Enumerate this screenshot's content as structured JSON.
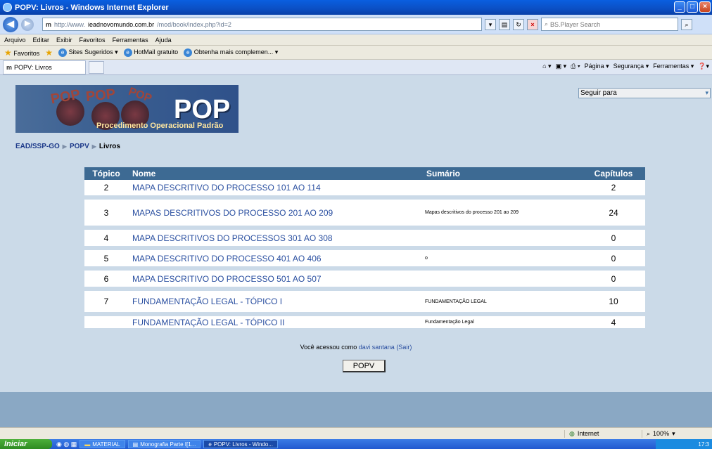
{
  "window": {
    "title": "POPV: Livros - Windows Internet Explorer"
  },
  "address": {
    "prefix": "http://www.",
    "domain": "ieadnovomundo.com.br",
    "path": "/mod/book/index.php?id=2"
  },
  "search": {
    "placeholder": "BS.Player Search"
  },
  "menu": [
    "Arquivo",
    "Editar",
    "Exibir",
    "Favoritos",
    "Ferramentas",
    "Ajuda"
  ],
  "favorites": {
    "label": "Favoritos",
    "items": [
      "Sites Sugeridos ▾",
      "HotMail gratuito",
      "Obtenha mais complemen... ▾"
    ]
  },
  "tab": {
    "label": "POPV: Livros"
  },
  "commands": [
    "Página ▾",
    "Segurança ▾",
    "Ferramentas ▾"
  ],
  "banner": {
    "big": "POP",
    "small": "POP",
    "subtitle": "Procedimento Operacional Padrão"
  },
  "jump": {
    "label": "Seguir para"
  },
  "breadcrumb": {
    "home": "EAD/SSP-GO",
    "course": "POPV",
    "current": "Livros"
  },
  "table": {
    "headers": {
      "topic": "Tópico",
      "name": "Nome",
      "summary": "Sumário",
      "chapters": "Capítulos"
    },
    "rows": [
      {
        "topic": "2",
        "name": "MAPA DESCRITIVO DO PROCESSO 101 AO 114",
        "summary": "",
        "chapters": "2"
      },
      {
        "topic": "3",
        "name": "MAPAS DESCRITIVOS DO PROCESSO 201 AO 209",
        "summary": "Mapas descritivos do processo 201 ao 209",
        "chapters": "24"
      },
      {
        "topic": "4",
        "name": "MAPA DESCRITIVOS DO PROCESSOS 301 AO 308",
        "summary": "",
        "chapters": "0"
      },
      {
        "topic": "5",
        "name": "MAPA DESCRITIVO DO PROCESSO 401 AO 406",
        "summary": "o",
        "chapters": "0"
      },
      {
        "topic": "6",
        "name": "MAPA DESCRITIVO DO PROCESSO 501 AO 507",
        "summary": "",
        "chapters": "0"
      },
      {
        "topic": "7",
        "name": "FUNDAMENTAÇÃO LEGAL - TÓPICO I",
        "summary": "FUNDAMENTAÇÃO LEGAL",
        "chapters": "10"
      },
      {
        "topic": "",
        "name": "FUNDAMENTAÇÃO LEGAL - TÓPICO II",
        "summary": "Fundamentação Legal",
        "chapters": "4"
      }
    ]
  },
  "footer": {
    "prefix": "Você acessou como",
    "user": "davi santana",
    "logout": "(Sair)",
    "button": "POPV"
  },
  "status": {
    "zone": "Internet",
    "zoom": "100%"
  },
  "taskbar": {
    "start": "Iniciar",
    "tasks": [
      "MATERIAL",
      "Monografia Parte I[1...",
      "POPV: Livros - Windo..."
    ],
    "clock": "17:3"
  }
}
